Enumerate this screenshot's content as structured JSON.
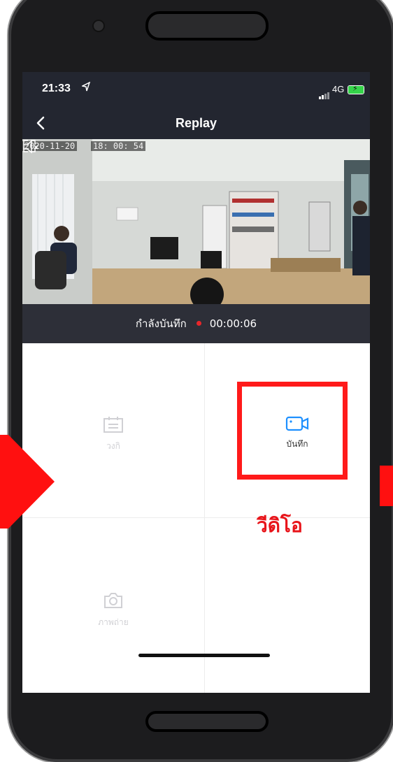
{
  "status_bar": {
    "time": "21:33",
    "location_icon": "location-arrow-icon",
    "network": "4G",
    "battery_icon": "battery-charging-icon"
  },
  "nav": {
    "title": "Replay",
    "back_icon": "chevron-left-icon"
  },
  "video": {
    "date": "2020-11-20",
    "time": "18: 00: 54"
  },
  "recording": {
    "label": "กำลังบันทึก",
    "elapsed": "00:00:06",
    "dot_color": "#e8262a"
  },
  "actions": [
    {
      "id": "clip",
      "label": "วงกิ",
      "icon": "clip-list-icon",
      "enabled": false
    },
    {
      "id": "record",
      "label": "บันทึก",
      "icon": "video-camera-icon",
      "enabled": true,
      "color": "#1e90ff"
    },
    {
      "id": "snapshot",
      "label": "ภาพถ่าย",
      "icon": "camera-icon",
      "enabled": false
    }
  ],
  "annotation": {
    "caption": "วีดิโอ",
    "color": "#ff1a1a"
  }
}
